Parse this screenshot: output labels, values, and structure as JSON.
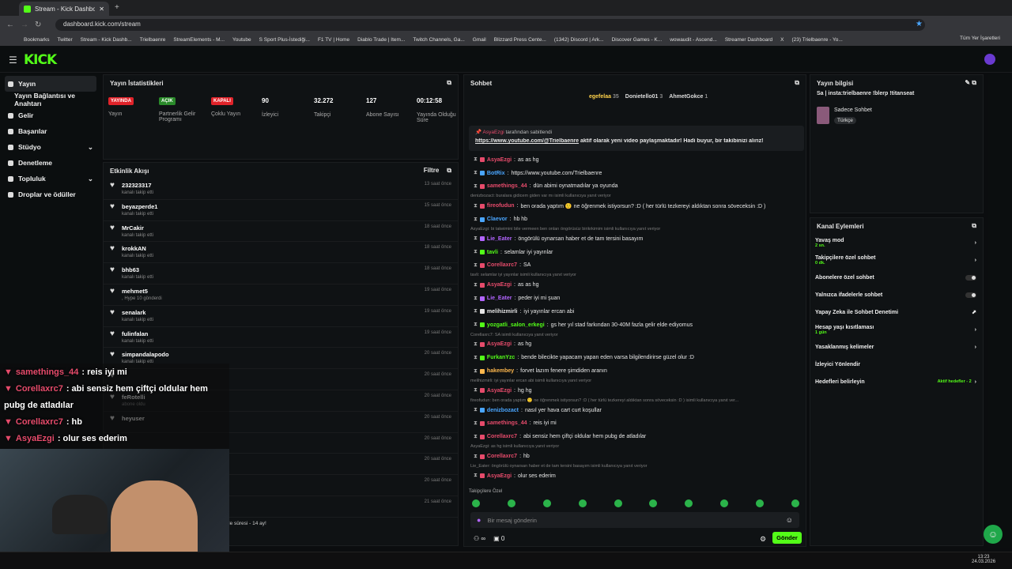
{
  "browser": {
    "tab_title": "Stream - Kick Dashboard",
    "url": "dashboard.kick.com/stream",
    "bookmarks": [
      "Bookmarks",
      "Twitter",
      "Stream - Kick Dashb...",
      "Trielbaenre",
      "StreamElements - M...",
      "Youtube",
      "S Sport Plus-İstediği...",
      "F1 TV | Home",
      "Diablo Trade | Item...",
      "Twitch Channels, Ga...",
      "Gmail",
      "Blizzard Press Cente...",
      "(1342) Discord | Ark...",
      "Discover Games - K...",
      "wowaudit - Ascend...",
      "Streamer Dashboard",
      "X",
      "(23) Trielbaenre - Yo..."
    ],
    "all_bookmarks": "Tüm Yer İşaretleri"
  },
  "brand": {
    "logo": "KICK",
    "accent": "#53fc18"
  },
  "sidebar": {
    "items": [
      {
        "label": "Yayın",
        "icon": "broadcast-icon"
      },
      {
        "label": "Yayın Bağlantısı ve Anahtarı",
        "icon": ""
      },
      {
        "label": "Gelir",
        "icon": "dollar-icon"
      },
      {
        "label": "Başarılar",
        "icon": "trophy-icon"
      },
      {
        "label": "Stüdyo",
        "icon": "studio-icon"
      },
      {
        "label": "Denetleme",
        "icon": "hammer-icon"
      },
      {
        "label": "Topluluk",
        "icon": "community-icon"
      },
      {
        "label": "Droplar ve ödüller",
        "icon": "gift-icon"
      }
    ]
  },
  "stats": {
    "title": "Yayın İstatistikleri",
    "items": [
      {
        "badge": "YAYINDA",
        "badge_color": "#e0232a",
        "label": "Yayın"
      },
      {
        "badge": "AÇIK",
        "badge_color": "#2a8a2a",
        "label": "Partnerlik Gelir Programı"
      },
      {
        "badge": "KAPALI",
        "badge_color": "#e0232a",
        "label": "Çoklu Yayın"
      },
      {
        "value": "90",
        "label": "İzleyici"
      },
      {
        "value": "32.272",
        "label": "Takipçi"
      },
      {
        "value": "127",
        "label": "Abone Sayısı"
      },
      {
        "value": "00:12:58",
        "label": "Yayında Olduğu Süre"
      }
    ]
  },
  "activity": {
    "title": "Etkinlik Akışı",
    "filter": "Filtre",
    "events": [
      {
        "user": "232323317",
        "action": "kanalı takip etti",
        "time": "13 saat önce"
      },
      {
        "user": "beyazperde1",
        "action": "kanalı takip etti",
        "time": "15 saat önce"
      },
      {
        "user": "MrCakir",
        "action": "kanalı takip etti",
        "time": "18 saat önce"
      },
      {
        "user": "krokkAN",
        "action": "kanalı takip etti",
        "time": "18 saat önce"
      },
      {
        "user": "bhb63",
        "action": "kanalı takip etti",
        "time": "18 saat önce"
      },
      {
        "user": "mehmet5",
        "action": ", Hype 10 gönderdi",
        "time": "19 saat önce"
      },
      {
        "user": "senalark",
        "action": "kanalı takip etti",
        "time": "19 saat önce"
      },
      {
        "user": "fulinfalan",
        "action": "kanalı takip etti",
        "time": "19 saat önce"
      },
      {
        "user": "simpandalapodo",
        "action": "kanalı takip etti",
        "time": "20 saat önce"
      },
      {
        "user": "",
        "action": "",
        "time": "20 saat önce"
      },
      {
        "user": "feRotelli",
        "action": "abone oldu",
        "time": "20 saat önce"
      },
      {
        "user": "heyuser",
        "action": "",
        "time": "20 saat önce"
      },
      {
        "user": "",
        "action": "",
        "time": "20 saat önce"
      },
      {
        "user": "",
        "action": "",
        "time": "20 saat önce"
      },
      {
        "user": "",
        "action": "",
        "time": "20 saat önce"
      },
      {
        "user": "",
        "action": "",
        "time": "21 saat önce"
      }
    ],
    "footer": "likle süresi - 14 ay!"
  },
  "chat": {
    "title": "Sohbet",
    "top_gifters": [
      {
        "name": "egefelaa",
        "count": "35"
      },
      {
        "name": "Donietello01",
        "count": "3"
      },
      {
        "name": "AhmetGokce",
        "count": "1"
      }
    ],
    "pinned": {
      "by": "AsyaEzgi",
      "by_suffix": "tarafından sabitlendi",
      "link": "https://www.youtube.com/@Trielbaenre",
      "text": "aktif olarak yeni video paylaşmaktadır! Hadi buyur, bir takibinizi alırız!"
    },
    "messages": [
      {
        "type": "msg",
        "user": "AsyaEzgi",
        "color": "#e64b6b",
        "text": "as as hg"
      },
      {
        "type": "msg",
        "user": "BotRix",
        "color": "#4aa6ff",
        "text": "https://www.youtube.com/Trielbaenre"
      },
      {
        "type": "msg",
        "user": "samethings_44",
        "color": "#e64b6b",
        "text": "dün abimi oynatmadılar ya oyunda"
      },
      {
        "type": "reply",
        "text": "denizbozact: buralara gidicem giden var mı isimli kullanıcıya yanıt veriyor"
      },
      {
        "type": "msg",
        "user": "fireofudun",
        "color": "#e64b6b",
        "text": "ben orada yaptım 🙂 ne öğrenmek istiyorsun? :D ( her türlü tezkereyi aldıktan sonra söveceksin :D )"
      },
      {
        "type": "msg",
        "user": "Claevor",
        "color": "#4aa6ff",
        "text": "hb hb"
      },
      {
        "type": "reply",
        "text": "AsyaEzgi: bi takeimini bile vermeen ben onları öngörüsüz birikrkimim isimli kullanıcıya yanıt veriyor"
      },
      {
        "type": "msg",
        "user": "Lie_Eater",
        "color": "#b265ff",
        "text": "öngörülü oynarsan haber et de tam tersini basayım"
      },
      {
        "type": "msg",
        "user": "tavli",
        "color": "#53fc18",
        "text": "selamlar iyi yayınlar"
      },
      {
        "type": "msg",
        "user": "Corellaxrc7",
        "color": "#e64b6b",
        "text": "SA"
      },
      {
        "type": "reply",
        "text": "tavli: selamlar iyi yayınlar isimli kullanıcıya yanıt veriyor"
      },
      {
        "type": "msg",
        "user": "AsyaEzgi",
        "color": "#e64b6b",
        "text": "as as hg"
      },
      {
        "type": "msg",
        "user": "Lie_Eater",
        "color": "#b265ff",
        "text": "peder iyi mi şuan"
      },
      {
        "type": "msg",
        "user": "melihizmirli",
        "color": "#e6e6e6",
        "text": "iyi yayınlar ercan abi"
      },
      {
        "type": "msg",
        "user": "yozgatli_salon_erkegi",
        "color": "#53fc18",
        "text": "gs her yıl stad farkından 30-40M fazla gelir elde ediyomus"
      },
      {
        "type": "reply",
        "text": "Corellaxrc7: SA isimli kullanıcıya yanıt veriyor"
      },
      {
        "type": "msg",
        "user": "AsyaEzgi",
        "color": "#e64b6b",
        "text": "as hg"
      },
      {
        "type": "msg",
        "user": "FurkanYzc",
        "color": "#53fc18",
        "text": "bende bilecikte yapacam yapan eden varsa bilgilendirirse güzel olur :D"
      },
      {
        "type": "msg",
        "user": "hakembey",
        "color": "#ffb84d",
        "text": "forvet lazım fenere şimdiden aranın"
      },
      {
        "type": "reply",
        "text": "melihizmirli: iyi yayınlar ercan abi isimli kullanıcıya yanıt veriyor"
      },
      {
        "type": "msg",
        "user": "AsyaEzgi",
        "color": "#e64b6b",
        "text": "hg hg"
      },
      {
        "type": "reply",
        "text": "fireofudun: ben orada yaptım 🙂 ne öğrenmek istiyorsun? :D ( her türlü tezkereyi aldıktan sonra söveceksin :D ) isimli kullanıcıya yanıt ver..."
      },
      {
        "type": "msg",
        "user": "denizbozact",
        "color": "#4aa6ff",
        "text": "nasıl yer hava cart curt koşullar"
      },
      {
        "type": "msg",
        "user": "samethings_44",
        "color": "#e64b6b",
        "text": "reis iyi mi"
      },
      {
        "type": "msg",
        "user": "Corellaxrc7",
        "color": "#e64b6b",
        "text": "abi sensiz hem çiftçi oldular hem pubg de atladılar"
      },
      {
        "type": "reply",
        "text": "AsyaEzgi: as hg isimli kullanıcıya yanıt veriyor"
      },
      {
        "type": "msg",
        "user": "Corellaxrc7",
        "color": "#e64b6b",
        "text": "hb"
      },
      {
        "type": "reply",
        "text": "Lie_Eater: öngörülü oynarsan haber et de tam tersini basayım isimli kullanıcıya yanıt veriyor"
      },
      {
        "type": "msg",
        "user": "AsyaEzgi",
        "color": "#e64b6b",
        "text": "olur ses ederim"
      }
    ],
    "follower_emotes_label": "Takipçilere Özel",
    "input_placeholder": "Bir mesaj gönderin",
    "count_a": "∞",
    "count_b": "0",
    "send_label": "Gönder"
  },
  "info": {
    "title": "Yayın bilgisi",
    "stream_title": "Sa | insta:trielbaenre !blerp !titanseat",
    "category": "Sadece Sohbet",
    "tag": "Türkçe"
  },
  "actions": {
    "title": "Kanal Eylemleri",
    "items": [
      {
        "label": "Yavaş mod",
        "sub": "2 sn.",
        "control": "arrow"
      },
      {
        "label": "Takipçilere özel sohbet",
        "sub": "0 dk.",
        "control": "arrow"
      },
      {
        "label": "Abonelere özel sohbet",
        "sub": "",
        "control": "toggle"
      },
      {
        "label": "Yalnızca ifadelerle sohbet",
        "sub": "",
        "control": "toggle"
      },
      {
        "label": "Yapay Zeka ile Sohbet Denetimi",
        "sub": "",
        "control": "external"
      },
      {
        "label": "Hesap yaşı kısıtlaması",
        "sub": "1 gün",
        "control": "arrow"
      },
      {
        "label": "Yasaklanmış kelimeler",
        "sub": "",
        "control": "arrow"
      },
      {
        "label": "İzleyici Yönlendir",
        "sub": "",
        "control": ""
      },
      {
        "label": "Hedefleri belirleyin",
        "sub": "",
        "control": "arrow",
        "extra": "Aktif hedefler - 2"
      }
    ]
  },
  "overlay_chat": [
    {
      "user": "samethings_44",
      "color": "#e64b6b",
      "text": ": reis iyi mi"
    },
    {
      "user": "Corellaxrc7",
      "color": "#e64b6b",
      "text": ": abi sensiz hem çiftçi oldular hem"
    },
    {
      "user": "",
      "color": "#ffffff",
      "text": "pubg de atladılar"
    },
    {
      "user": "Corellaxrc7",
      "color": "#e64b6b",
      "text": ": hb"
    },
    {
      "user": "AsyaEzgi",
      "color": "#e64b6b",
      "text": ": olur ses ederim"
    }
  ],
  "clock": {
    "time": "13:23",
    "date": "24.03.2026"
  }
}
